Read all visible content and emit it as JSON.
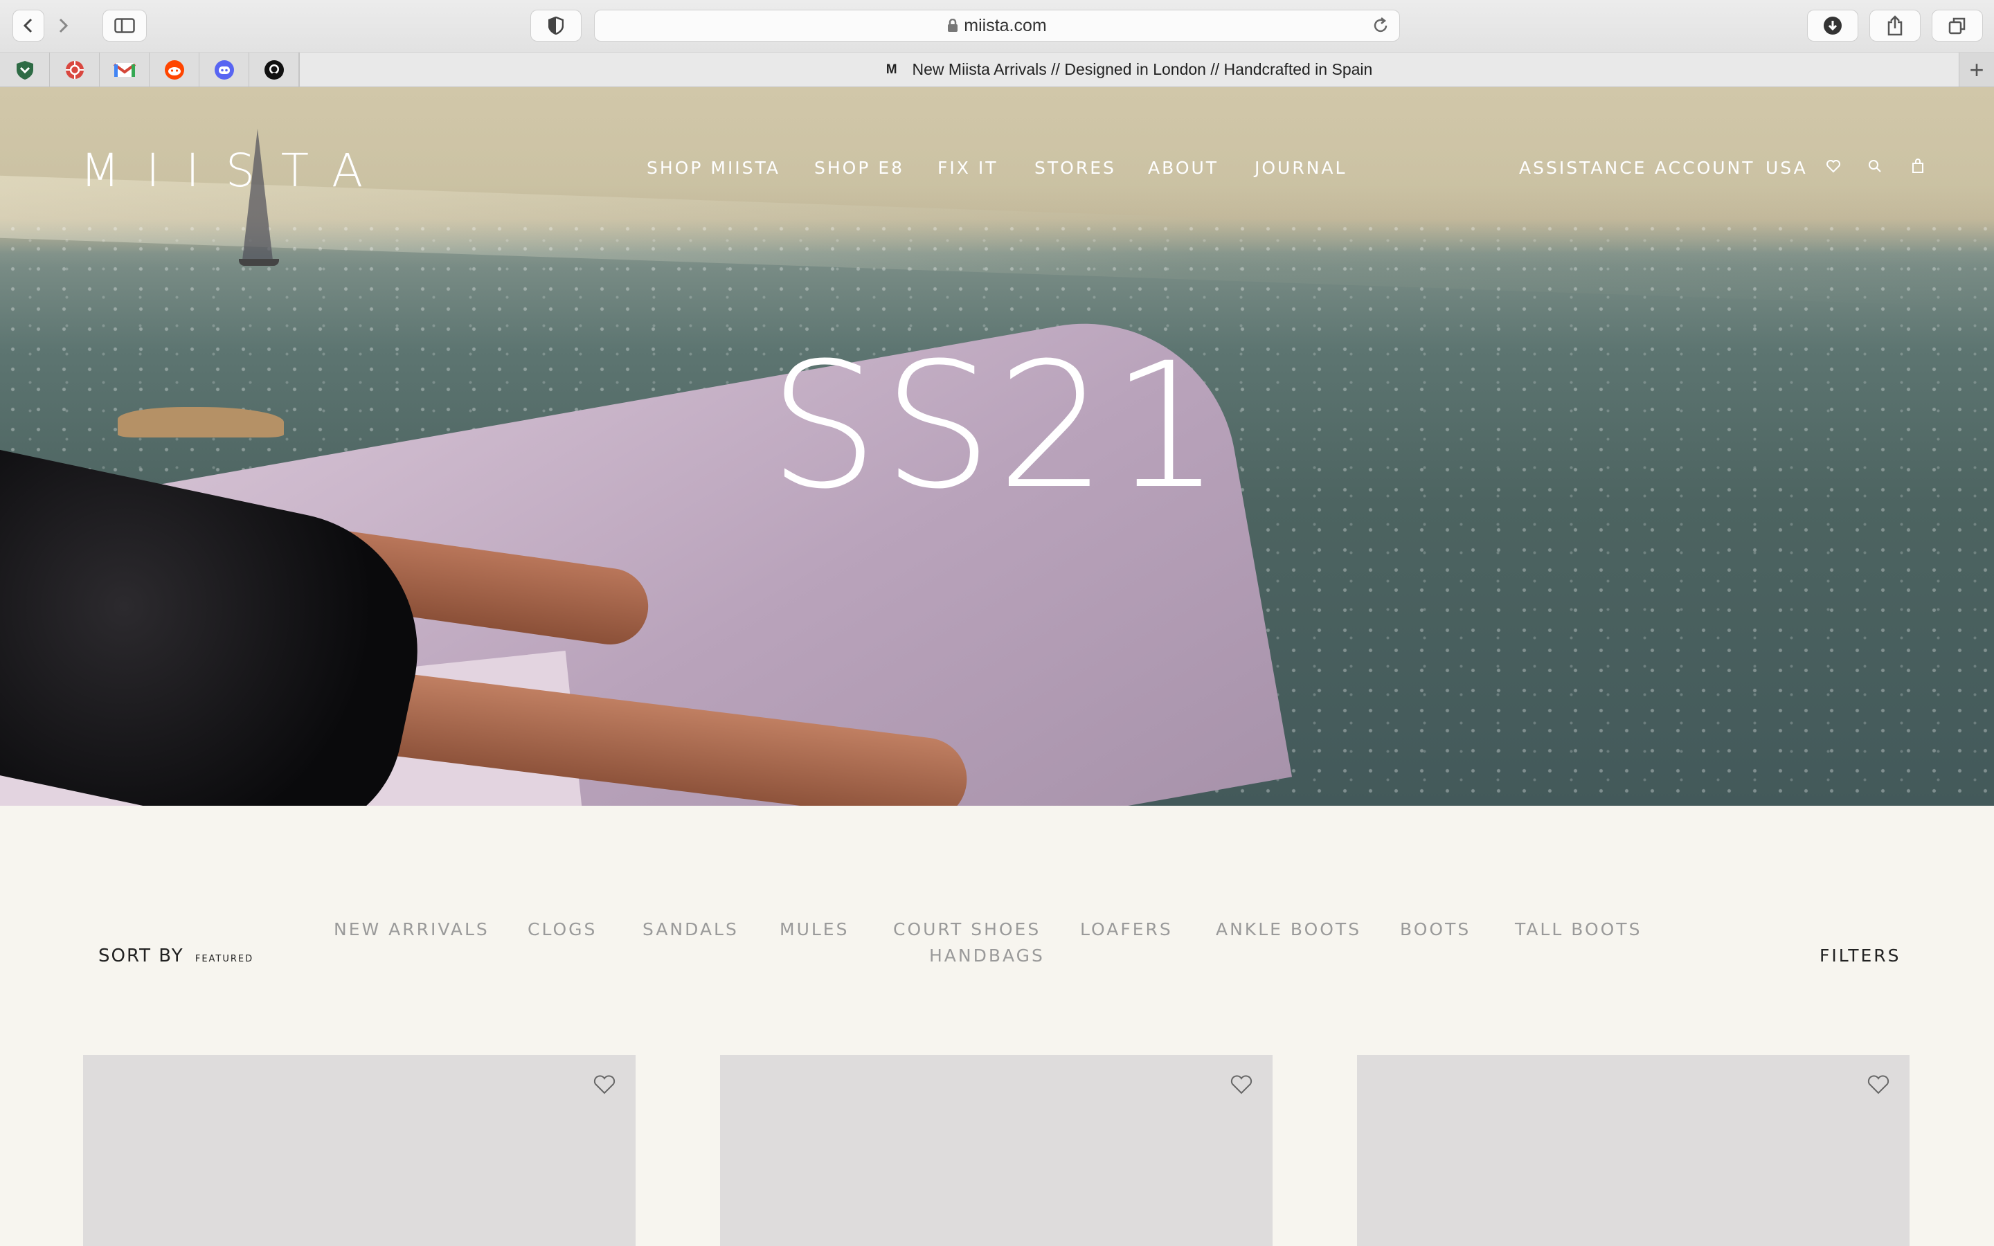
{
  "browser": {
    "url": "miista.com",
    "tab_title": "New Miista Arrivals // Designed in London // Handcrafted in Spain",
    "tab_favicon": "M",
    "favorites": [
      "shield-icon",
      "aperture-icon",
      "gmail-icon",
      "reddit-icon",
      "discord-icon",
      "github-icon"
    ],
    "toolbar_icons": [
      "back-icon",
      "forward-icon",
      "sidebar-icon",
      "privacy-shield-icon",
      "download-icon",
      "share-icon",
      "tabs-icon",
      "new-tab-icon"
    ]
  },
  "site": {
    "logo": "MIISTA",
    "nav_left": [
      "SHOP MIISTA",
      "SHOP E8",
      "FIX IT",
      "STORES",
      "ABOUT",
      "JOURNAL"
    ],
    "nav_right": [
      "ASSISTANCE",
      "ACCOUNT",
      "USA"
    ],
    "nav_icons": [
      "heart-icon",
      "search-icon",
      "bag-icon"
    ]
  },
  "hero": {
    "title": "SS21"
  },
  "catalog": {
    "sort_label": "SORT BY",
    "sort_value": "FEATURED",
    "categories": [
      "NEW ARRIVALS",
      "CLOGS",
      "SANDALS",
      "MULES",
      "COURT SHOES",
      "LOAFERS",
      "ANKLE BOOTS",
      "BOOTS",
      "TALL BOOTS",
      "HANDBAGS"
    ],
    "filters_label": "FILTERS"
  },
  "colors": {
    "page_bg": "#f7f5ef",
    "card_bg": "#dedcdc",
    "category_text": "#9a9a9a"
  }
}
